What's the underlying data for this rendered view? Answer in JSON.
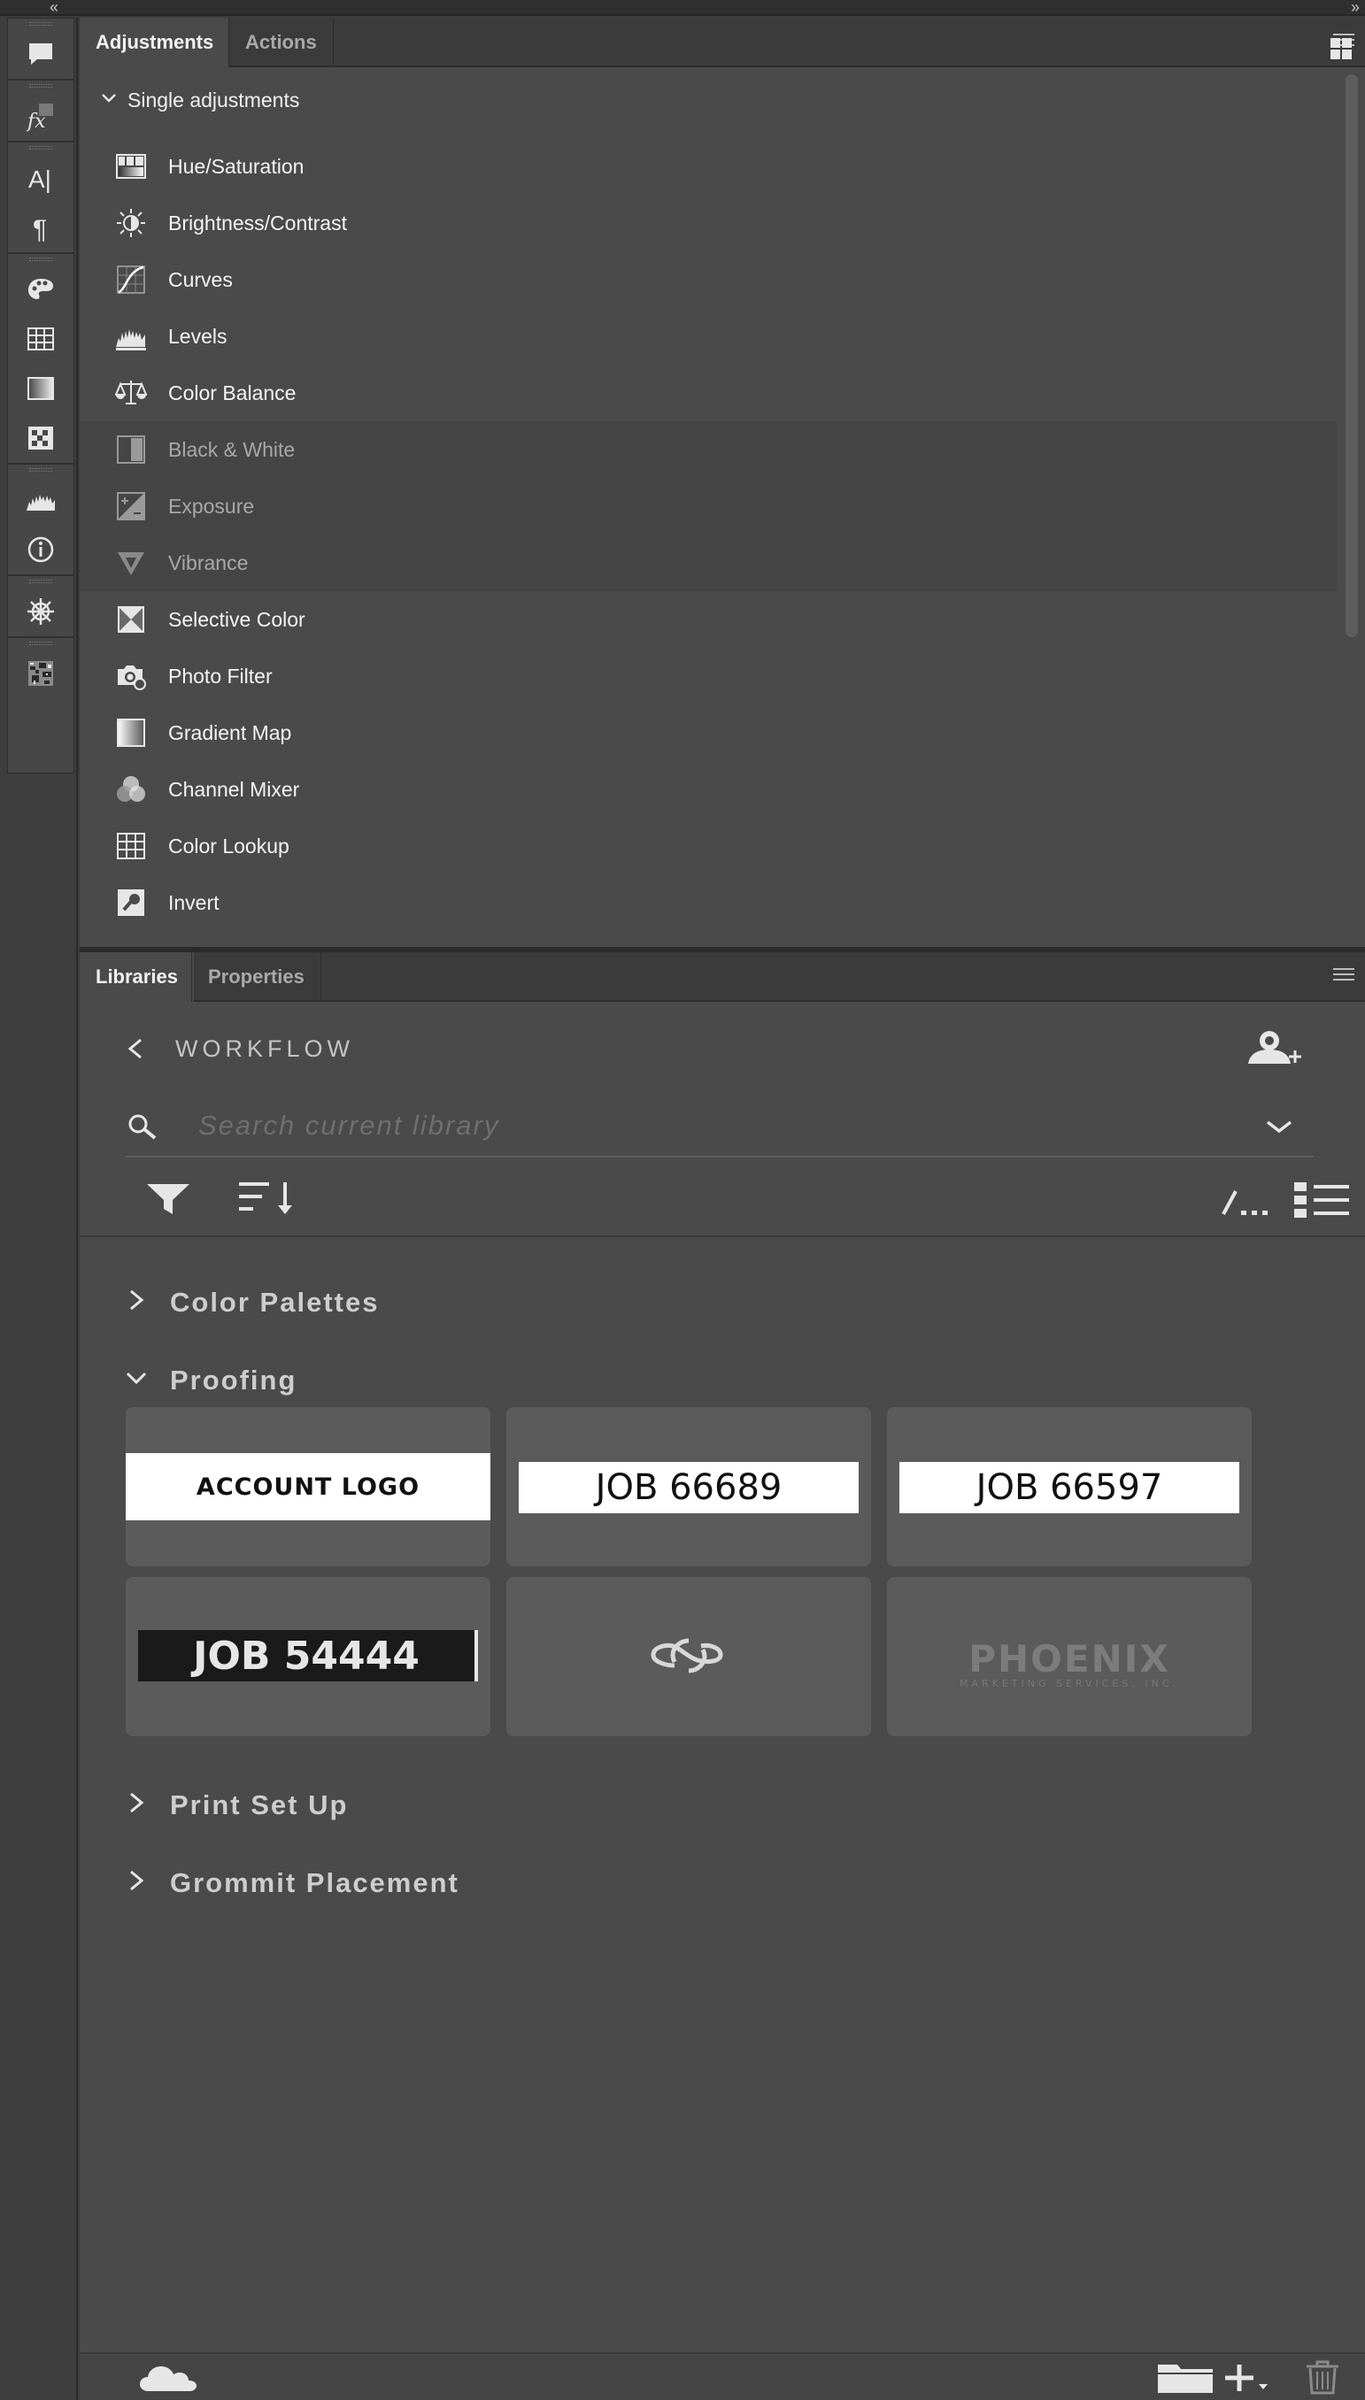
{
  "top_strip": {
    "collapse_left": "‹‹",
    "expand_right": "››"
  },
  "toolbar": {
    "tools": [
      "comment-icon",
      "fx-icon",
      "character-icon",
      "paragraph-icon",
      "color-palette-icon",
      "swatches-icon",
      "gradients-icon",
      "patterns-icon",
      "histogram-icon",
      "info-icon",
      "navigator-icon",
      "image-thumbnail-icon"
    ],
    "fx_label": "fx",
    "char_label": "A|",
    "para_label": "¶"
  },
  "adjustments_panel": {
    "tabs": [
      "Adjustments",
      "Actions"
    ],
    "section_title": "Single adjustments",
    "items": [
      {
        "label": "Hue/Saturation",
        "icon": "hue-saturation-icon",
        "dimmed": false
      },
      {
        "label": "Brightness/Contrast",
        "icon": "brightness-contrast-icon",
        "dimmed": false
      },
      {
        "label": "Curves",
        "icon": "curves-icon",
        "dimmed": false
      },
      {
        "label": "Levels",
        "icon": "levels-icon",
        "dimmed": false
      },
      {
        "label": "Color Balance",
        "icon": "color-balance-icon",
        "dimmed": false
      },
      {
        "label": "Black & White",
        "icon": "black-white-icon",
        "dimmed": true
      },
      {
        "label": "Exposure",
        "icon": "exposure-icon",
        "dimmed": true
      },
      {
        "label": "Vibrance",
        "icon": "vibrance-icon",
        "dimmed": true
      },
      {
        "label": "Selective Color",
        "icon": "selective-color-icon",
        "dimmed": false
      },
      {
        "label": "Photo Filter",
        "icon": "photo-filter-icon",
        "dimmed": false
      },
      {
        "label": "Gradient Map",
        "icon": "gradient-map-icon",
        "dimmed": false
      },
      {
        "label": "Channel Mixer",
        "icon": "channel-mixer-icon",
        "dimmed": false
      },
      {
        "label": "Color Lookup",
        "icon": "color-lookup-icon",
        "dimmed": false
      },
      {
        "label": "Invert",
        "icon": "invert-icon",
        "dimmed": false
      }
    ]
  },
  "libraries_panel": {
    "tabs": [
      "Libraries",
      "Properties"
    ],
    "library_name": "WORKFLOW",
    "search_placeholder": "Search current library",
    "groups": [
      {
        "name": "Color Palettes",
        "expanded": false
      },
      {
        "name": "Proofing",
        "expanded": true
      },
      {
        "name": "Print Set Up",
        "expanded": false
      },
      {
        "name": "Grommit Placement",
        "expanded": false
      }
    ],
    "proofing_tiles": [
      {
        "type": "text",
        "text": "ACCOUNT LOGO"
      },
      {
        "type": "text",
        "text": "JOB 66689"
      },
      {
        "type": "text",
        "text": "JOB 66597"
      },
      {
        "type": "text",
        "text": "JOB 54444"
      },
      {
        "type": "icon",
        "icon": "creative-cloud-icon"
      },
      {
        "type": "logo",
        "text": "PHOENIX",
        "subtext": "MARKETING SERVICES, INC."
      }
    ]
  },
  "colors": {
    "panel_bg": "#4a4a4a",
    "tab_bar": "#3b3b3b",
    "text": "#f4f4f4",
    "dim_text": "#a8a8a8",
    "tile_bg": "#5b5b5b"
  }
}
